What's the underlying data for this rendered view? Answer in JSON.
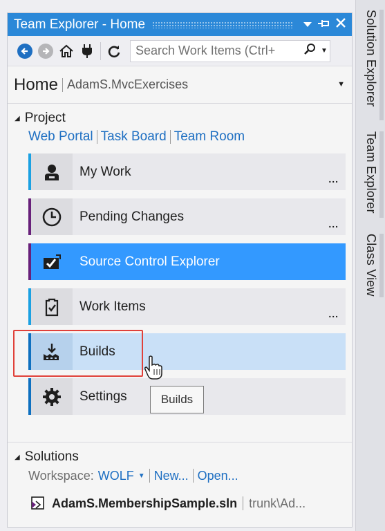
{
  "window": {
    "title": "Team Explorer - Home",
    "title_icons": [
      "dropdown-icon",
      "pin-icon",
      "close-icon"
    ]
  },
  "toolbar": {
    "search_placeholder": "Search Work Items (Ctrl+"
  },
  "header": {
    "title": "Home",
    "project": "AdamS.MvcExercises"
  },
  "project_section": {
    "title": "Project",
    "links": [
      "Web Portal",
      "Task Board",
      "Team Room"
    ]
  },
  "tiles": [
    {
      "label": "My Work",
      "icon": "user-icon",
      "stripe": "#1ba1e2",
      "more": "..."
    },
    {
      "label": "Pending Changes",
      "icon": "clock-icon",
      "stripe": "#68217a",
      "more": "..."
    },
    {
      "label": "Source Control Explorer",
      "icon": "source-control-icon",
      "stripe": "#68217a",
      "state": "selected"
    },
    {
      "label": "Work Items",
      "icon": "clipboard-check-icon",
      "stripe": "#1ba1e2",
      "more": "..."
    },
    {
      "label": "Builds",
      "icon": "build-icon",
      "stripe": "#0e70c0",
      "state": "hover"
    },
    {
      "label": "Settings",
      "icon": "gear-icon",
      "stripe": "#0e70c0"
    }
  ],
  "tooltip": "Builds",
  "solutions_section": {
    "title": "Solutions",
    "workspace_label": "Workspace:",
    "workspace_value": "WOLF",
    "links": [
      "New...",
      "Open..."
    ],
    "solution_name": "AdamS.MembershipSample.sln",
    "solution_path": "trunk\\Ad..."
  },
  "side_tabs": [
    "Solution Explorer",
    "Team Explorer",
    "Class View"
  ],
  "colors": {
    "title_bar": "#2b88d8",
    "selected": "#3399ff",
    "hover": "#c9e0f7",
    "link": "#1e6fc2",
    "highlight_box": "#e0413a"
  }
}
